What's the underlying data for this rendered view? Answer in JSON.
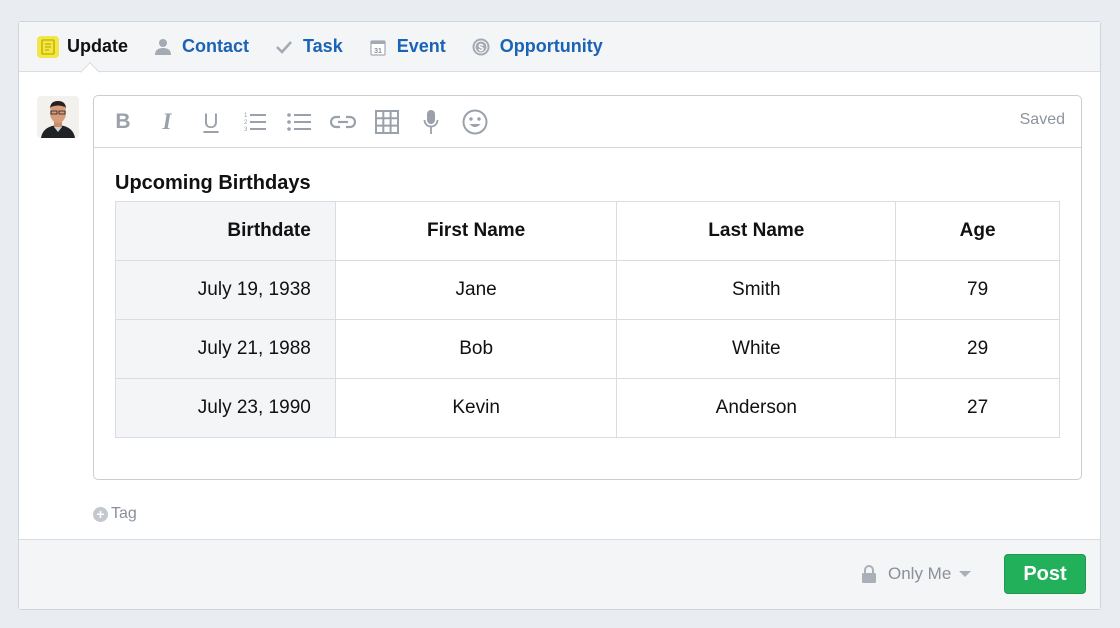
{
  "tabs": [
    {
      "label": "Update",
      "icon": "note-icon",
      "active": true
    },
    {
      "label": "Contact",
      "icon": "person-icon",
      "active": false
    },
    {
      "label": "Task",
      "icon": "check-icon",
      "active": false
    },
    {
      "label": "Event",
      "icon": "calendar-icon",
      "active": false,
      "calendar_day": "31"
    },
    {
      "label": "Opportunity",
      "icon": "dollar-coin-icon",
      "active": false
    }
  ],
  "editor": {
    "status": "Saved",
    "toolbar": [
      "bold",
      "italic",
      "underline",
      "numbered-list",
      "bulleted-list",
      "link",
      "table",
      "microphone",
      "emoji"
    ],
    "toolbar_labels": {
      "bold": "B",
      "italic": "I",
      "underline": "U"
    },
    "heading": "Upcoming Birthdays",
    "table": {
      "headers": [
        "Birthdate",
        "First Name",
        "Last Name",
        "Age"
      ],
      "rows": [
        [
          "July 19, 1938",
          "Jane",
          "Smith",
          "79"
        ],
        [
          "July 21, 1988",
          "Bob",
          "White",
          "29"
        ],
        [
          "July 23, 1990",
          "Kevin",
          "Anderson",
          "27"
        ]
      ]
    }
  },
  "tag": {
    "label": "Tag",
    "plus": "+"
  },
  "footer": {
    "privacy": "Only Me",
    "post_label": "Post"
  },
  "colors": {
    "accent_link": "#1a63b5",
    "post_green": "#22b05a",
    "note_yellow": "#f2e64a"
  }
}
